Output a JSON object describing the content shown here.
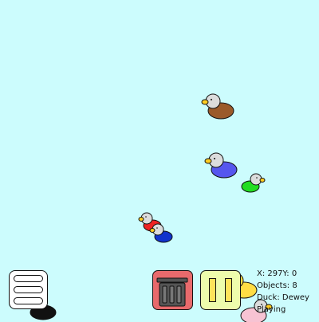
{
  "game": {
    "background_color": "#ccfcfd"
  },
  "status": {
    "position": "X: 297Y: 0",
    "objects": "Objects: 8",
    "duck": "Duck: Dewey",
    "state": "Playing"
  },
  "toolbar": {
    "menu_icon": "hamburger-menu-icon",
    "trash_icon": "trash-can-icon",
    "pause_icon": "pause-icon",
    "trash_color": "#e86a6c",
    "pause_color": "#eefcac"
  },
  "ducks": [
    {
      "body_color": "#9b5a2a"
    },
    {
      "body_color": "#5656ee"
    },
    {
      "body_color": "#22dd22"
    },
    {
      "body_color": "#ee2222"
    },
    {
      "body_color": "#1133cc"
    },
    {
      "body_color": "#111111"
    },
    {
      "body_color": "#ffdd44"
    },
    {
      "body_color": "#f7c3d3"
    }
  ]
}
